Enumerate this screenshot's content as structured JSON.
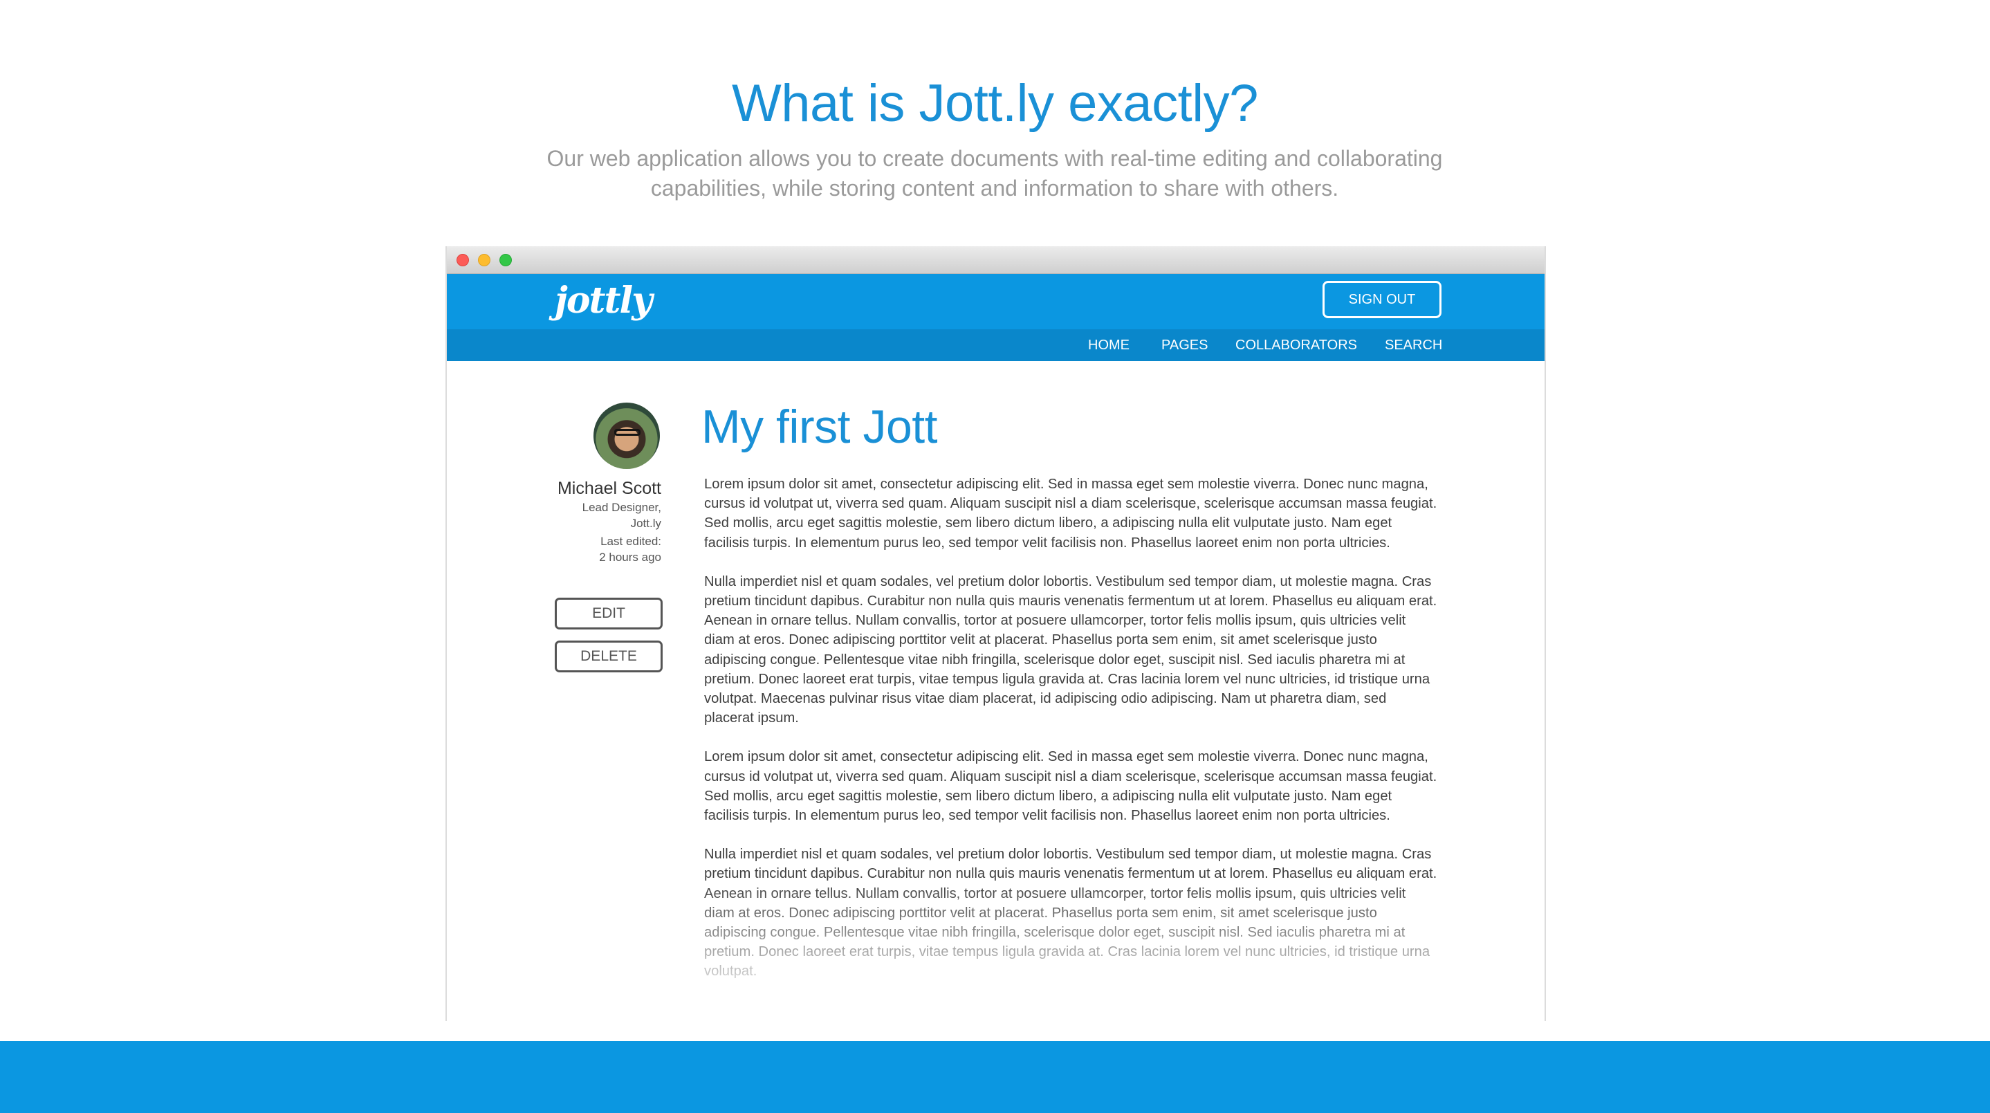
{
  "hero": {
    "title": "What is Jott.ly exactly?",
    "subtitle": "Our web application allows you to create documents with real-time editing and collaborating capabilities, while storing content and information to share with others."
  },
  "app": {
    "logo_text": "jottly",
    "sign_out_label": "SIGN OUT",
    "nav": [
      "HOME",
      "PAGES",
      "COLLABORATORS",
      "SEARCH"
    ],
    "colors": {
      "primary": "#0b97e1",
      "nav_dark": "#0a87cb",
      "title_blue": "#1a90d6"
    }
  },
  "author": {
    "name": "Michael Scott",
    "role_line1": "Lead Designer,",
    "role_line2": "Jott.ly",
    "edited_label": "Last edited:",
    "edited_time": "2 hours ago"
  },
  "actions": {
    "edit": "EDIT",
    "delete": "DELETE"
  },
  "document": {
    "title": "My first Jott",
    "paragraphs": [
      "Lorem ipsum dolor sit amet, consectetur adipiscing elit. Sed in massa eget sem molestie viverra. Donec nunc magna, cursus id volutpat ut, viverra sed quam. Aliquam suscipit nisl a diam scelerisque, scelerisque accumsan massa feugiat. Sed mollis, arcu eget sagittis molestie, sem libero dictum libero, a adipiscing nulla elit vulputate justo. Nam eget facilisis turpis. In elementum purus leo, sed tempor velit facilisis non. Phasellus laoreet enim non porta ultricies.",
      "Nulla imperdiet nisl et quam sodales, vel pretium dolor lobortis. Vestibulum sed tempor diam, ut molestie magna. Cras pretium tincidunt dapibus. Curabitur non nulla quis mauris venenatis fermentum ut at lorem. Phasellus eu aliquam erat. Aenean in ornare tellus. Nullam convallis, tortor at posuere ullamcorper, tortor felis mollis ipsum, quis ultricies velit diam at eros. Donec adipiscing porttitor velit at placerat. Phasellus porta sem enim, sit amet scelerisque justo adipiscing congue. Pellentesque vitae nibh fringilla, scelerisque dolor eget, suscipit nisl. Sed iaculis pharetra mi at pretium. Donec laoreet erat turpis, vitae tempus ligula gravida at. Cras lacinia lorem vel nunc ultricies, id tristique urna volutpat. Maecenas pulvinar risus vitae diam placerat, id adipiscing odio adipiscing. Nam ut pharetra diam, sed placerat ipsum.",
      "Lorem ipsum dolor sit amet, consectetur adipiscing elit. Sed in massa eget sem molestie viverra. Donec nunc magna, cursus id volutpat ut, viverra sed quam. Aliquam suscipit nisl a diam scelerisque, scelerisque accumsan massa feugiat. Sed mollis, arcu eget sagittis molestie, sem libero dictum libero, a adipiscing nulla elit vulputate justo. Nam eget facilisis turpis. In elementum purus leo, sed tempor velit facilisis non. Phasellus laoreet enim non porta ultricies.",
      "Nulla imperdiet nisl et quam sodales, vel pretium dolor lobortis. Vestibulum sed tempor diam, ut molestie magna. Cras pretium tincidunt dapibus. Curabitur non nulla quis mauris venenatis fermentum ut at lorem. Phasellus eu aliquam erat. Aenean in ornare tellus. Nullam convallis, tortor at posuere ullamcorper, tortor felis mollis ipsum, quis ultricies velit diam at eros. Donec adipiscing porttitor velit at placerat. Phasellus porta sem enim, sit amet scelerisque justo adipiscing congue. Pellentesque vitae nibh fringilla, scelerisque dolor eget, suscipit nisl. Sed iaculis pharetra mi at pretium. Donec laoreet erat turpis, vitae tempus ligula gravida at. Cras lacinia lorem vel nunc ultricies, id tristique urna volutpat."
    ]
  }
}
